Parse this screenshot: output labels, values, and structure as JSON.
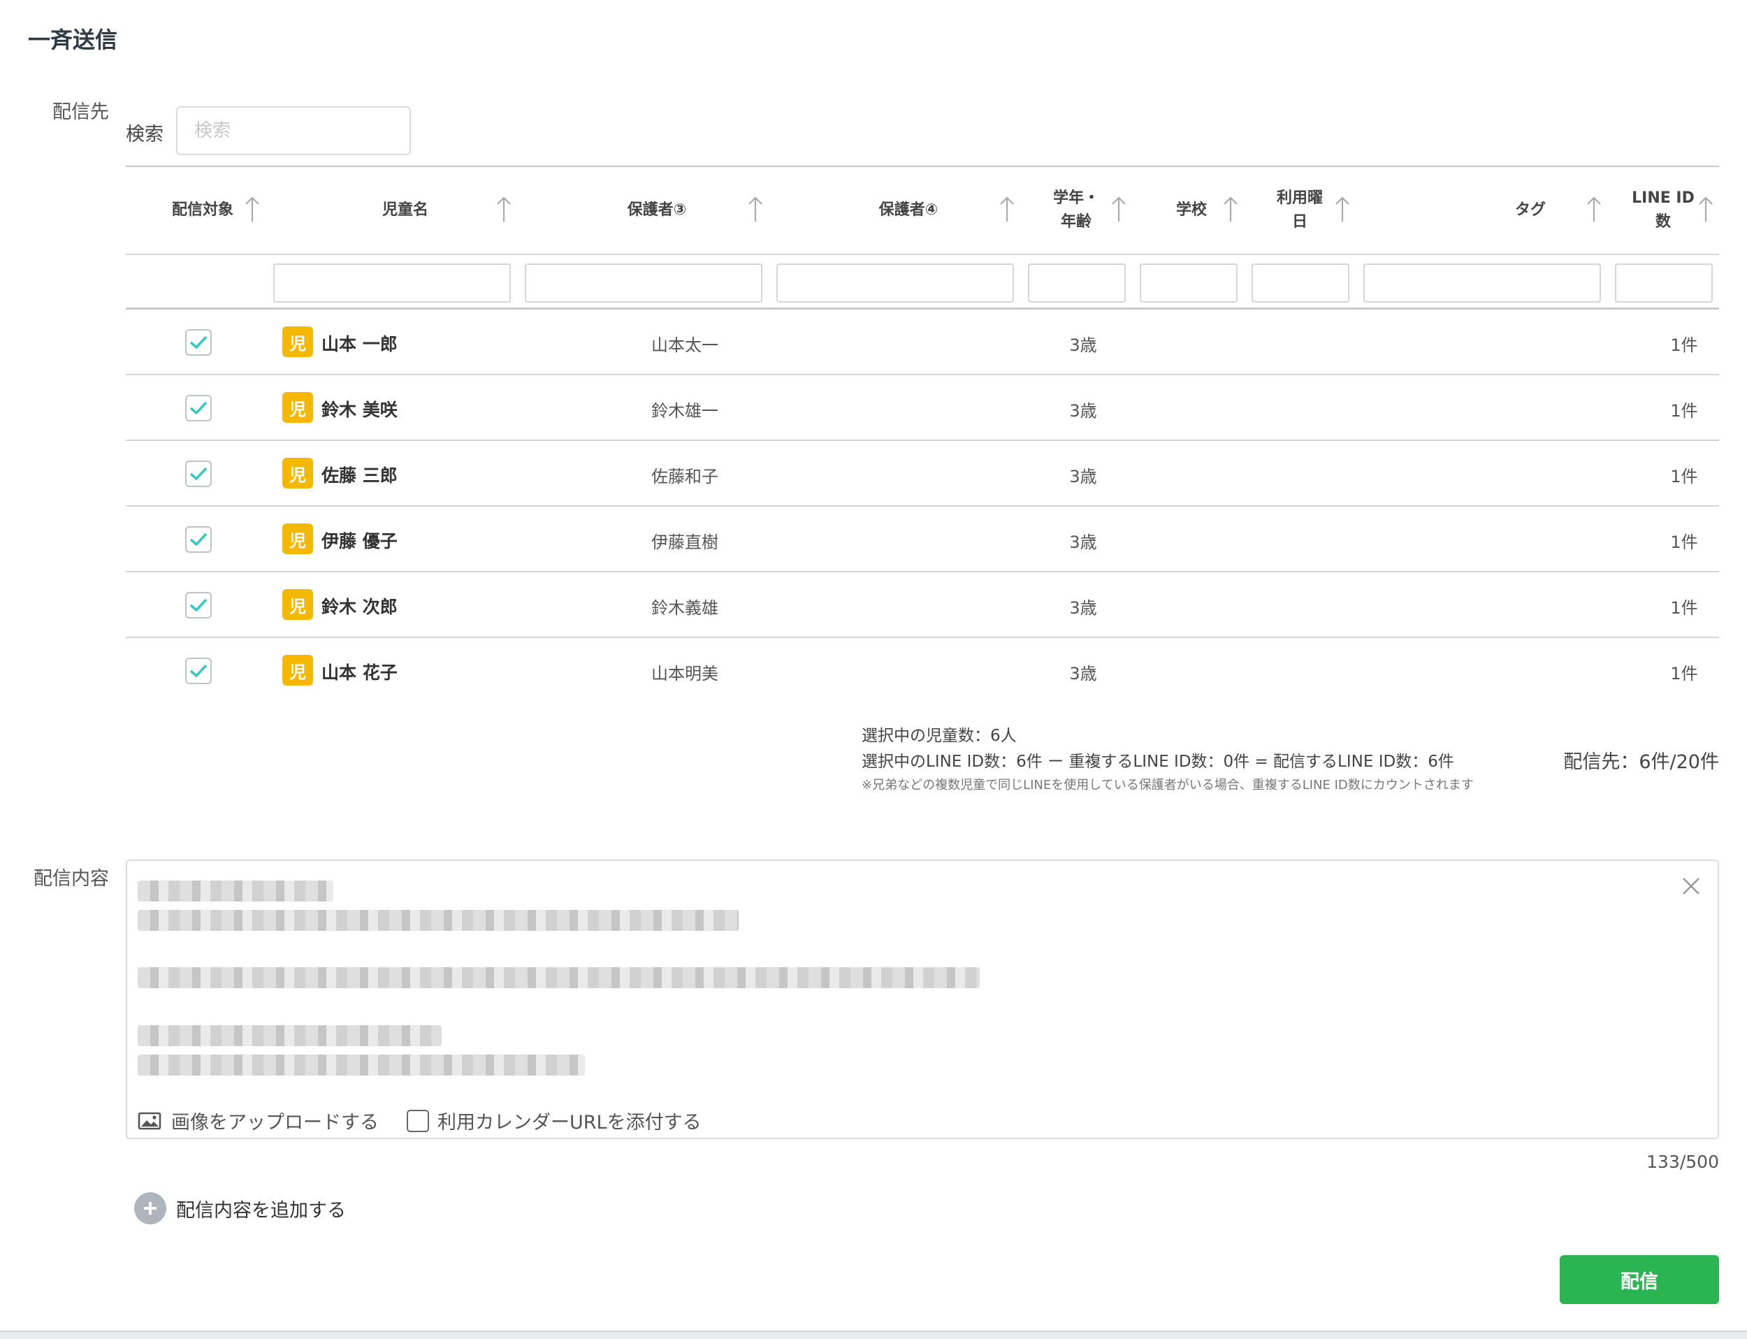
{
  "page": {
    "title": "一斉送信"
  },
  "destination": {
    "label": "配信先",
    "search_label": "検索",
    "search_placeholder": "検索"
  },
  "table": {
    "columns": [
      {
        "label": "配信対象"
      },
      {
        "label": "児童名"
      },
      {
        "label": "保護者③"
      },
      {
        "label": "保護者④"
      },
      {
        "label": "学年・年齢"
      },
      {
        "label": "学校"
      },
      {
        "label": "利用曜日"
      },
      {
        "label": "タグ"
      },
      {
        "label": "LINE ID数"
      }
    ],
    "child_badge": "児",
    "rows": [
      {
        "checked": true,
        "child": "山本 一郎",
        "guardian": "山本太一",
        "grade": "3歳",
        "line_ids": "1件"
      },
      {
        "checked": true,
        "child": "鈴木 美咲",
        "guardian": "鈴木雄一",
        "grade": "3歳",
        "line_ids": "1件"
      },
      {
        "checked": true,
        "child": "佐藤 三郎",
        "guardian": "佐藤和子",
        "grade": "3歳",
        "line_ids": "1件"
      },
      {
        "checked": true,
        "child": "伊藤 優子",
        "guardian": "伊藤直樹",
        "grade": "3歳",
        "line_ids": "1件"
      },
      {
        "checked": true,
        "child": "鈴木 次郎",
        "guardian": "鈴木義雄",
        "grade": "3歳",
        "line_ids": "1件"
      },
      {
        "checked": true,
        "child": "山本 花子",
        "guardian": "山本明美",
        "grade": "3歳",
        "line_ids": "1件"
      }
    ]
  },
  "summary": {
    "selected_children": "選択中の児童数：6人",
    "line_id_calc": "選択中のLINE ID数：6件 ー 重複するLINE ID数：0件 = 配信するLINE ID数：6件",
    "note": "※兄弟などの複数児童で同じLINEを使用している保護者がいる場合、重複するLINE ID数にカウントされます",
    "destination_count": "配信先：6件/20件"
  },
  "content": {
    "label": "配信内容",
    "upload_image": "画像をアップロードする",
    "attach_calendar": "利用カレンダーURLを添付する",
    "char_count": "133/500",
    "add_content": "配信内容を追加する"
  },
  "actions": {
    "send": "配信"
  },
  "colors": {
    "accent_green": "#2bb552",
    "badge_yellow": "#f5b800",
    "check_teal": "#35c9c1"
  }
}
